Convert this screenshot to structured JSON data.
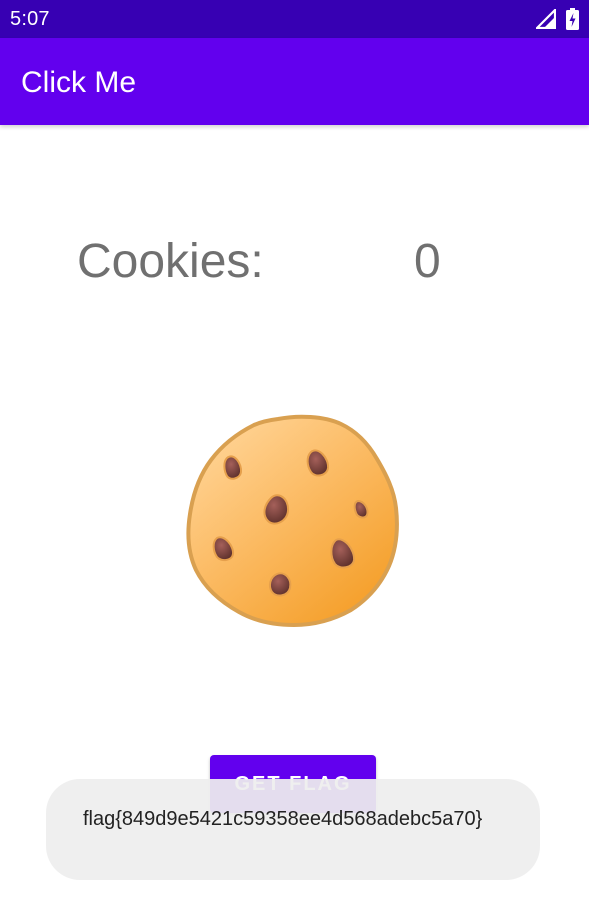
{
  "status_bar": {
    "time": "5:07",
    "icons": [
      "signal-icon",
      "battery-charging-icon"
    ]
  },
  "app_bar": {
    "title": "Click Me"
  },
  "counter": {
    "label": "Cookies:",
    "value": "0"
  },
  "cookie": {
    "icon": "cookie-icon"
  },
  "button": {
    "label": "GET FLAG"
  },
  "toast": {
    "message": "flag{849d9e5421c59358ee4d568adebc5a70}"
  },
  "colors": {
    "status_bar": "#3700b3",
    "app_bar": "#6200ee",
    "button": "#6200ee",
    "counter_text": "#707070",
    "toast_bg": "#eeeeee"
  }
}
